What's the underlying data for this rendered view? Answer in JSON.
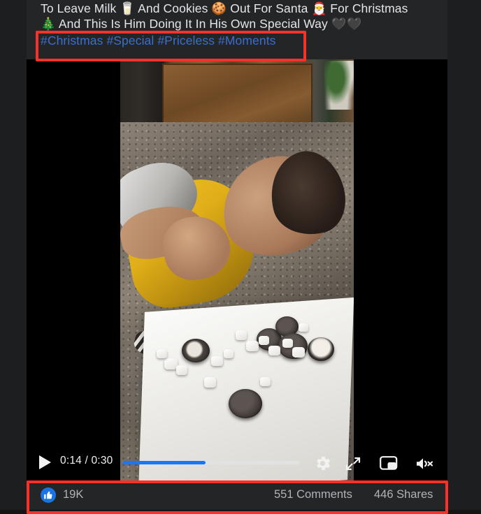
{
  "post": {
    "caption": {
      "line1": "To Leave Milk 🥛 And Cookies 🍪 Out For Santa 🎅 For Christmas",
      "line2": "🎄 And This Is Him Doing It In His Own Special Way 🖤🖤",
      "hashtags": "#Christmas #Special #Priceless #Moments",
      "hashtag_color": "#3a6fd0"
    },
    "video": {
      "description": "Child in a yellow shirt lying on a granite kitchen counter beside a white napkin holding Oreo cookies and marshmallows",
      "play_label": "▶",
      "time_display": "0:14 / 0:30",
      "current_time": "0:14",
      "duration": "0:30",
      "progress_percent": 47,
      "progress_color": "#1877f2",
      "controls": [
        {
          "name": "play-button",
          "icon": "play-icon"
        },
        {
          "name": "settings-button",
          "icon": "gear-icon"
        },
        {
          "name": "fullscreen-button",
          "icon": "expand-arrows-icon"
        },
        {
          "name": "picture-in-picture-button",
          "icon": "pip-icon"
        },
        {
          "name": "mute-button",
          "icon": "speaker-muted-icon"
        }
      ]
    },
    "engagement": {
      "reaction_icon": "thumbs-up-icon",
      "reaction_color": "#1b74e4",
      "like_count": "19K",
      "comments": "551 Comments",
      "shares": "446 Shares"
    }
  },
  "annotations": {
    "color": "#f8312b",
    "boxes": [
      {
        "name": "hashtags-highlight",
        "target": "hashtag row"
      },
      {
        "name": "engagement-highlight",
        "target": "likes, comments and shares row"
      }
    ]
  }
}
